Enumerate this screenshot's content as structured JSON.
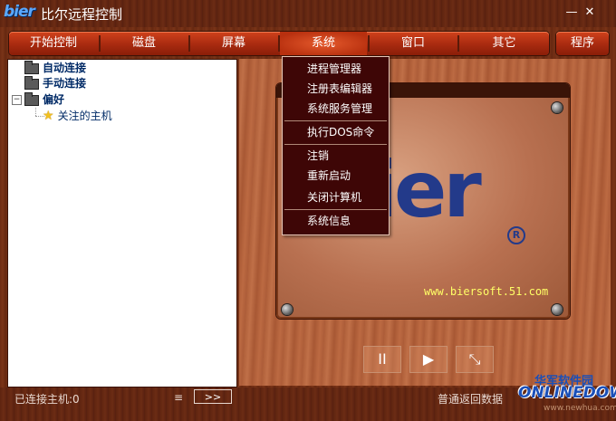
{
  "titlebar": {
    "logo": "bier",
    "title": "比尔远程控制",
    "minimize": "—",
    "close": "✕"
  },
  "menubar": {
    "items": [
      {
        "label": "开始控制"
      },
      {
        "label": "磁盘"
      },
      {
        "label": "屏幕"
      },
      {
        "label": "系统"
      },
      {
        "label": "窗口"
      },
      {
        "label": "其它"
      }
    ],
    "program_label": "程序"
  },
  "tree": {
    "nodes": [
      {
        "label": "自动连接"
      },
      {
        "label": "手动连接"
      },
      {
        "label": "偏好"
      },
      {
        "label": "关注的主机"
      }
    ],
    "expander_symbol": "−"
  },
  "dropdown": {
    "items": [
      {
        "label": "进程管理器"
      },
      {
        "label": "注册表编辑器"
      },
      {
        "label": "系统服务管理"
      },
      {
        "label": "执行DOS命令"
      },
      {
        "label": "注销"
      },
      {
        "label": "重新启动"
      },
      {
        "label": "关闭计算机"
      },
      {
        "label": "系统信息"
      }
    ]
  },
  "splash": {
    "logo": "bier",
    "registered": "R",
    "url": "www.biersoft.51.com"
  },
  "controls": {
    "pause": "II",
    "play": "▶",
    "resize": "⤡"
  },
  "statusbar": {
    "left": "已连接主机:0",
    "menu_symbol": "≡",
    "arrow": ">>",
    "right": "普通返回数据"
  },
  "watermark": {
    "line1": "华军软件园",
    "line2": "ONLINEDOWN",
    "line3": "www.newhua.com"
  }
}
